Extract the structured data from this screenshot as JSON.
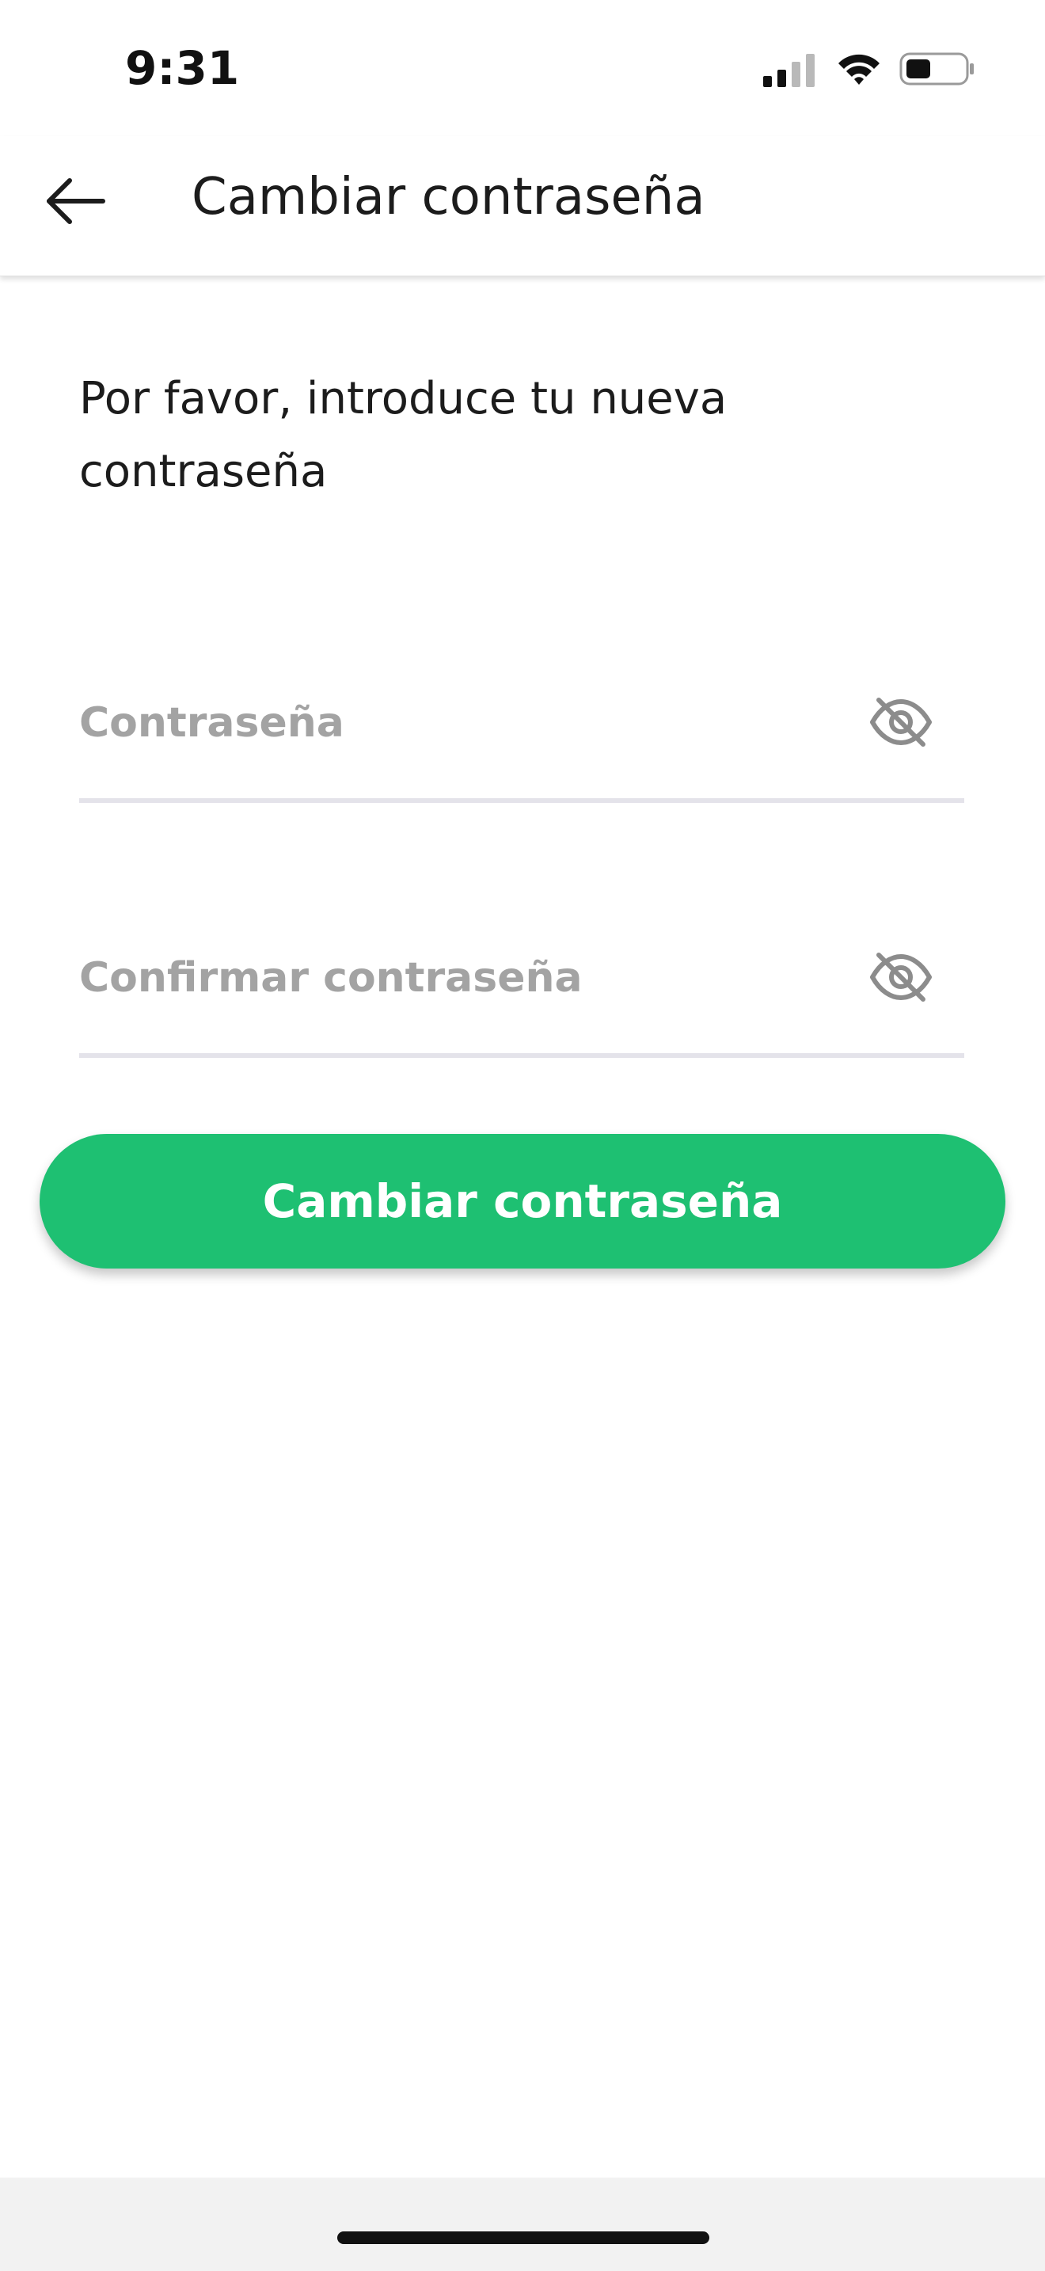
{
  "status_bar": {
    "time": "9:31",
    "icons": [
      "cellular-signal-icon",
      "wifi-icon",
      "battery-icon"
    ]
  },
  "app_bar": {
    "back_icon": "arrow-left-icon",
    "title": "Cambiar contraseña"
  },
  "form": {
    "intro_text": "Por favor, introduce tu nueva contraseña",
    "password": {
      "value": "",
      "placeholder": "Contraseña",
      "visibility_icon": "eye-off-icon"
    },
    "confirm_password": {
      "value": "",
      "placeholder": "Confirmar contraseña",
      "visibility_icon": "eye-off-icon"
    },
    "submit_label": "Cambiar contraseña"
  },
  "colors": {
    "accent": "#1ec072",
    "placeholder": "#a3a3a3",
    "field_underline": "#e4e3ea"
  }
}
